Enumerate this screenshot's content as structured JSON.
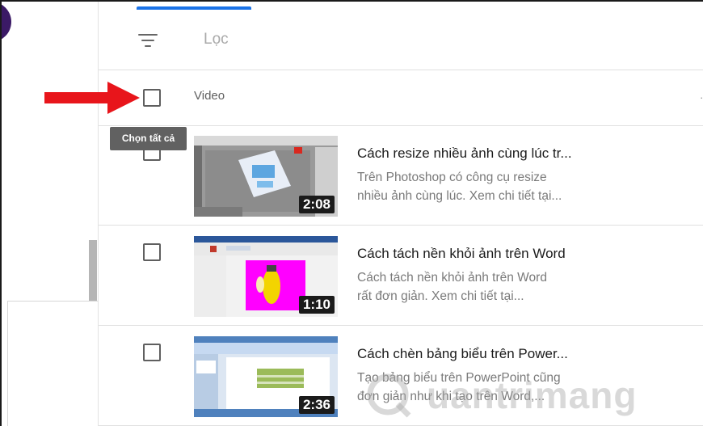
{
  "filter": {
    "placeholder": "Lọc"
  },
  "header": {
    "label": "Video",
    "more": "."
  },
  "tooltip": {
    "label": "Chọn tất cả"
  },
  "videos": [
    {
      "title": "Cách resize nhiều ảnh cùng lúc tr...",
      "desc_line1": "Trên Photoshop có công cụ resize",
      "desc_line2": "nhiều ảnh cùng lúc. Xem chi tiết tại...",
      "duration": "2:08"
    },
    {
      "title": "Cách tách nền khỏi ảnh trên Word",
      "desc_line1": "Cách tách nền khỏi ảnh trên Word",
      "desc_line2": "rất đơn giản. Xem chi tiết tại...",
      "duration": "1:10"
    },
    {
      "title": "Cách chèn bảng biểu trên Power...",
      "desc_line1": "Tạo bảng biểu trên PowerPoint cũng",
      "desc_line2": "đơn giản như khi tạo trên Word,...",
      "duration": "2:36"
    }
  ],
  "watermark": {
    "text": "uantrimang"
  },
  "colors": {
    "accent": "#1a73e8",
    "arrow": "#e8151b",
    "avatar": "#3b1a66",
    "word_bg": "#ff00ff"
  }
}
